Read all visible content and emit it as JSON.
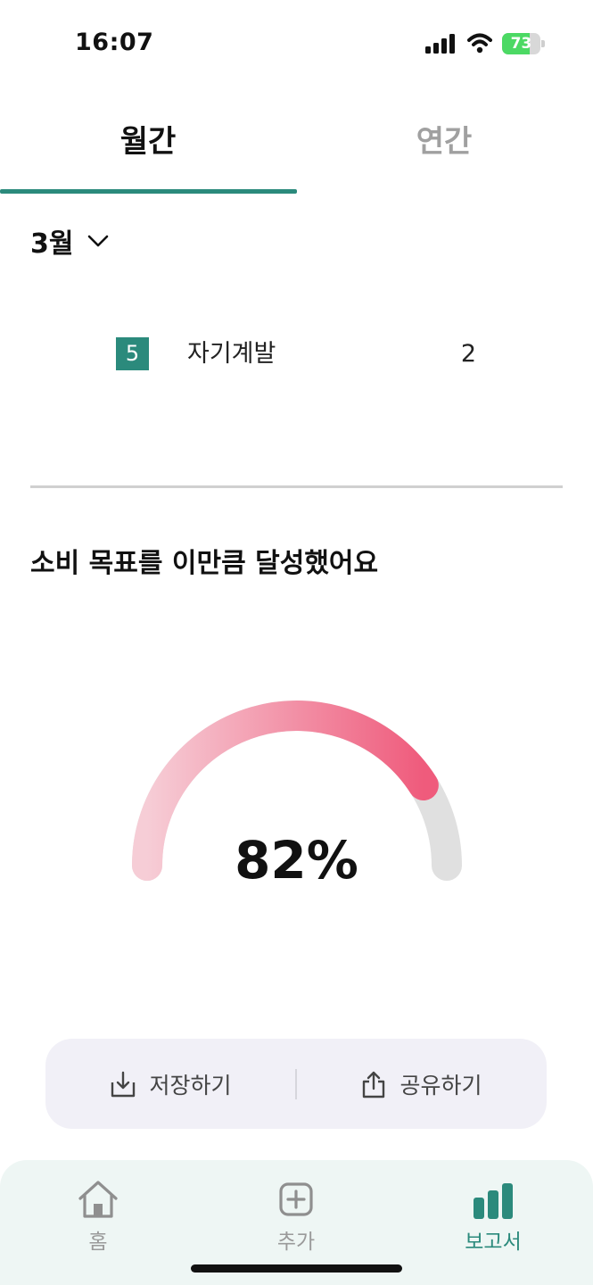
{
  "status_bar": {
    "time": "16:07",
    "battery": "73",
    "battery_level": 0.73,
    "icons": [
      "signal-icon",
      "wifi-icon",
      "battery-charging-icon"
    ]
  },
  "tabs": [
    {
      "label": "월간",
      "selected": true
    },
    {
      "label": "연간",
      "selected": false
    }
  ],
  "month_selector": {
    "label": "3월",
    "icon": "chevron-down-icon"
  },
  "category_list": [
    {
      "rank": "5",
      "name": "자기계발",
      "count": "2"
    }
  ],
  "goal": {
    "title": "소비 목표를 이만큼 달성했어요",
    "percent_label": "82%",
    "percent": 82
  },
  "actions": {
    "save": {
      "label": "저장하기",
      "icon": "download-icon"
    },
    "share": {
      "label": "공유하기",
      "icon": "share-icon"
    }
  },
  "bottom_nav": {
    "items": [
      {
        "label": "홈",
        "icon": "home-icon",
        "active": false
      },
      {
        "label": "추가",
        "icon": "plus-square-icon",
        "active": false
      },
      {
        "label": "보고서",
        "icon": "bar-chart-icon",
        "active": true
      }
    ]
  },
  "colors": {
    "accent": "#2b8a7c",
    "gauge_start": "#f6cdd6",
    "gauge_end": "#ef5b7c",
    "gauge_track": "#e0e0e0",
    "action_bar_bg": "#f1f0f7",
    "nav_bg": "#eef6f4"
  }
}
